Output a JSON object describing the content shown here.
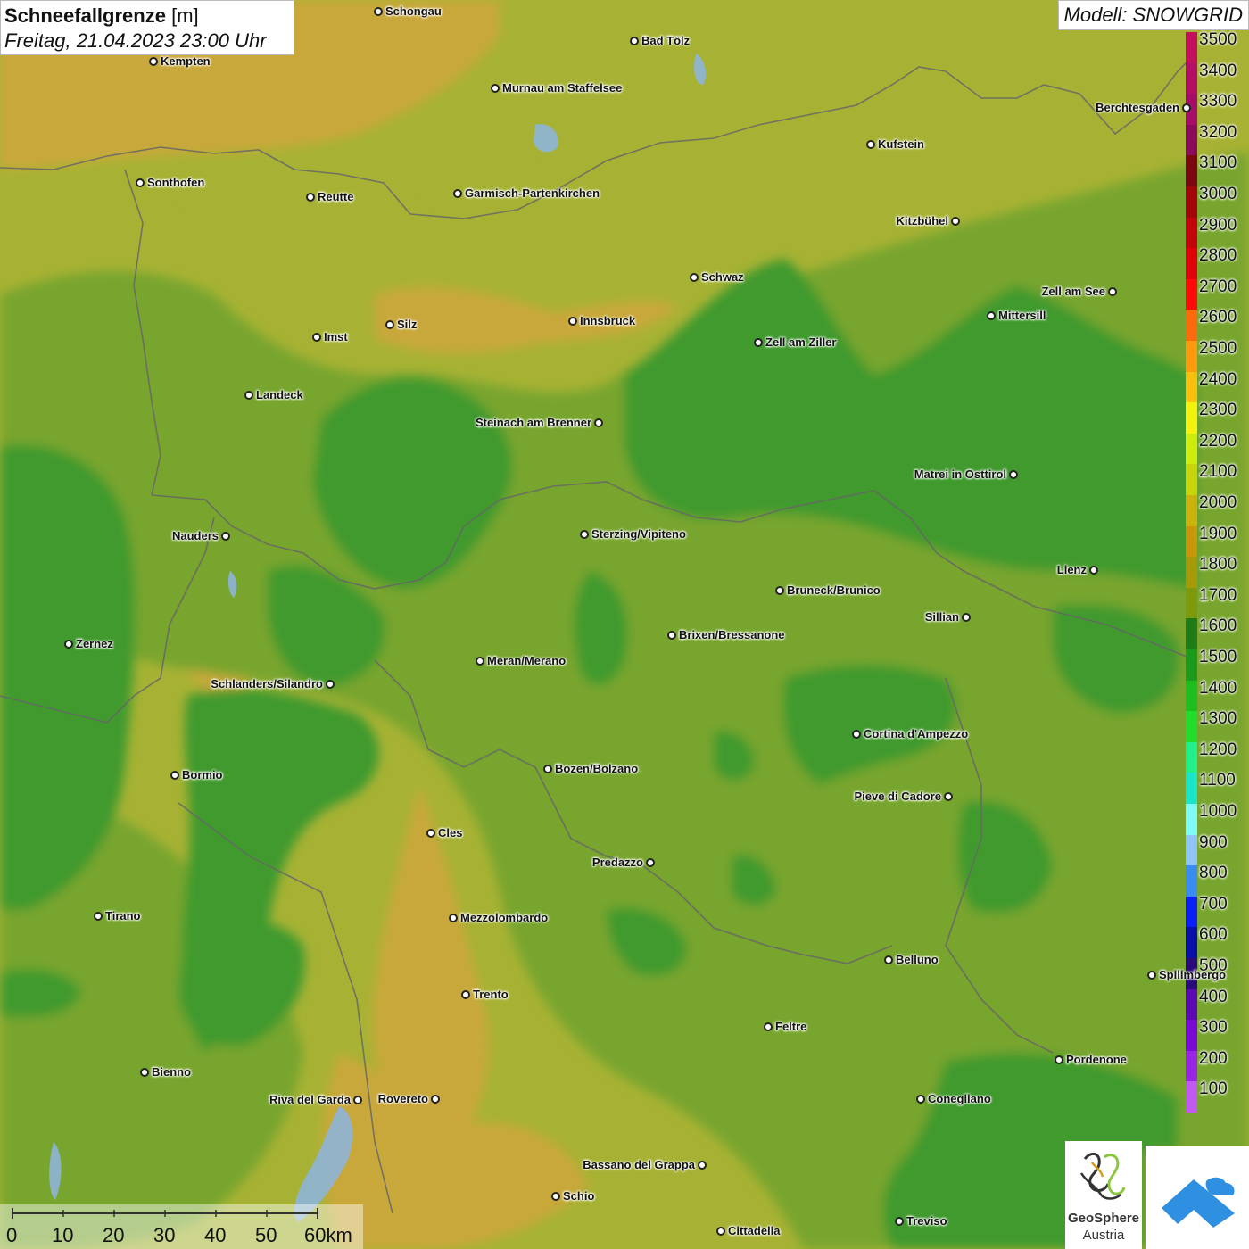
{
  "header": {
    "title": "Schneefallgrenze",
    "unit": "[m]",
    "datetime": "Freitag, 21.04.2023 23:00 Uhr"
  },
  "model_label": "Modell: SNOWGRID",
  "legend": {
    "levels": [
      {
        "label": "3500",
        "color": "#c2105e"
      },
      {
        "label": "3400",
        "color": "#b30f66"
      },
      {
        "label": "3300",
        "color": "#a50d6a"
      },
      {
        "label": "3200",
        "color": "#8a0a5c"
      },
      {
        "label": "3100",
        "color": "#7b0710"
      },
      {
        "label": "3000",
        "color": "#a3060a"
      },
      {
        "label": "2900",
        "color": "#c4040c"
      },
      {
        "label": "2800",
        "color": "#e0020a"
      },
      {
        "label": "2700",
        "color": "#fb0a0a"
      },
      {
        "label": "2600",
        "color": "#fb6a0c"
      },
      {
        "label": "2500",
        "color": "#fb9a0e"
      },
      {
        "label": "2400",
        "color": "#f7c00e"
      },
      {
        "label": "2300",
        "color": "#f2f20e"
      },
      {
        "label": "2200",
        "color": "#cdeb0d"
      },
      {
        "label": "2100",
        "color": "#c7d50c"
      },
      {
        "label": "2000",
        "color": "#cbb20c"
      },
      {
        "label": "1900",
        "color": "#c8960a"
      },
      {
        "label": "1800",
        "color": "#a79a0a"
      },
      {
        "label": "1700",
        "color": "#7c9a0c"
      },
      {
        "label": "1600",
        "color": "#1f7a18"
      },
      {
        "label": "1500",
        "color": "#1b9a1c"
      },
      {
        "label": "1400",
        "color": "#1cbf1e"
      },
      {
        "label": "1300",
        "color": "#22dd2a"
      },
      {
        "label": "1200",
        "color": "#21f08a"
      },
      {
        "label": "1100",
        "color": "#1ae5c8"
      },
      {
        "label": "1000",
        "color": "#7ffaf6"
      },
      {
        "label": "900",
        "color": "#8ec4f6"
      },
      {
        "label": "800",
        "color": "#3a8cf0"
      },
      {
        "label": "700",
        "color": "#0a1ef5"
      },
      {
        "label": "600",
        "color": "#0a0fa8"
      },
      {
        "label": "500",
        "color": "#2a0a7a"
      },
      {
        "label": "400",
        "color": "#5a0ab0"
      },
      {
        "label": "300",
        "color": "#7a0ad8"
      },
      {
        "label": "200",
        "color": "#9a24e4"
      },
      {
        "label": "100",
        "color": "#c05af0"
      }
    ]
  },
  "cities": [
    {
      "name": "Schongau"
    },
    {
      "name": "Bad Tölz"
    },
    {
      "name": "Kempten"
    },
    {
      "name": "Murnau am Staffelsee"
    },
    {
      "name": "Berchtesgaden"
    },
    {
      "name": "Kufstein"
    },
    {
      "name": "Sonthofen"
    },
    {
      "name": "Reutte"
    },
    {
      "name": "Garmisch-Partenkirchen"
    },
    {
      "name": "Kitzbühel"
    },
    {
      "name": "Schwaz"
    },
    {
      "name": "Zell am See"
    },
    {
      "name": "Mittersill"
    },
    {
      "name": "Innsbruck"
    },
    {
      "name": "Imst"
    },
    {
      "name": "Silz"
    },
    {
      "name": "Zell am Ziller"
    },
    {
      "name": "Landeck"
    },
    {
      "name": "Steinach am Brenner"
    },
    {
      "name": "Matrei in Osttirol"
    },
    {
      "name": "Nauders"
    },
    {
      "name": "Sterzing/Vipiteno"
    },
    {
      "name": "Lienz"
    },
    {
      "name": "Bruneck/Brunico"
    },
    {
      "name": "Sillian"
    },
    {
      "name": "Zernez"
    },
    {
      "name": "Brixen/Bressanone"
    },
    {
      "name": "Meran/Merano"
    },
    {
      "name": "Schlanders/Silandro"
    },
    {
      "name": "Cortina d'Ampezzo"
    },
    {
      "name": "Bormio"
    },
    {
      "name": "Bozen/Bolzano"
    },
    {
      "name": "Pieve di Cadore"
    },
    {
      "name": "Cles"
    },
    {
      "name": "Predazzo"
    },
    {
      "name": "Tirano"
    },
    {
      "name": "Mezzolombardo"
    },
    {
      "name": "Belluno"
    },
    {
      "name": "Spilimbergo"
    },
    {
      "name": "Trento"
    },
    {
      "name": "Feltre"
    },
    {
      "name": "Pordenone"
    },
    {
      "name": "Bienno"
    },
    {
      "name": "Riva del Garda"
    },
    {
      "name": "Rovereto"
    },
    {
      "name": "Conegliano"
    },
    {
      "name": "Bassano del Grappa"
    },
    {
      "name": "Schio"
    },
    {
      "name": "Treviso"
    },
    {
      "name": "Cittadella"
    }
  ],
  "scale": {
    "labels": [
      "0",
      "10",
      "20",
      "30",
      "40",
      "50",
      "60km"
    ]
  },
  "logos": {
    "geosphere_line1": "GeoSphere",
    "geosphere_line2": "Austria"
  },
  "colors": {
    "band_1600": "#3f9a2e",
    "band_1700": "#78a52e",
    "band_1800": "#a7b234",
    "band_1900": "#c9a83a"
  }
}
